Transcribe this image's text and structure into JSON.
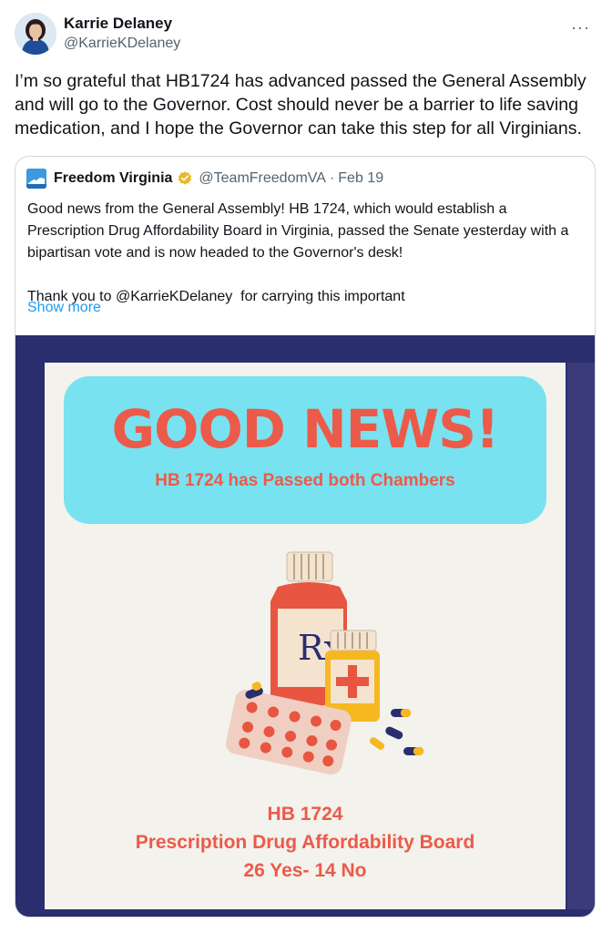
{
  "author": {
    "name": "Karrie Delaney",
    "handle": "@KarrieKDelaney"
  },
  "more_icon": "···",
  "tweet_text": "I’m so grateful that HB1724 has advanced passed the General Assembly and will go to the Governor. Cost should never be a barrier to life saving medication, and I hope the Governor can take this step for all Virginians.",
  "quote": {
    "name": "Freedom Virginia",
    "handle": "@TeamFreedomVA",
    "separator": "·",
    "date": "Feb 19",
    "text": "Good news from the General Assembly! HB 1724, which would establish a Prescription Drug Affordability Board in Virginia, passed the Senate yesterday with a bipartisan vote and is now headed to the Governor's desk!\n\nThank you to @KarrieKDelaney  for carrying this important",
    "show_more": "Show more"
  },
  "image": {
    "headline": "GOOD NEWS!",
    "subheadline": "HB 1724 has Passed both Chambers",
    "line1": "HB 1724",
    "line2": "Prescription Drug Affordability Board",
    "line3": "26 Yes- 14 No",
    "rx_label": "Rx"
  },
  "colors": {
    "accent_link": "#1d9bf0",
    "media_frame": "#2a2d6e",
    "headline_red": "#ec5a4a",
    "banner_cyan": "#78e2f0",
    "verified_gold": "#e8b829"
  },
  "icons": [
    "more-icon",
    "verified-badge-icon",
    "freedom-virginia-logo",
    "avatar"
  ]
}
